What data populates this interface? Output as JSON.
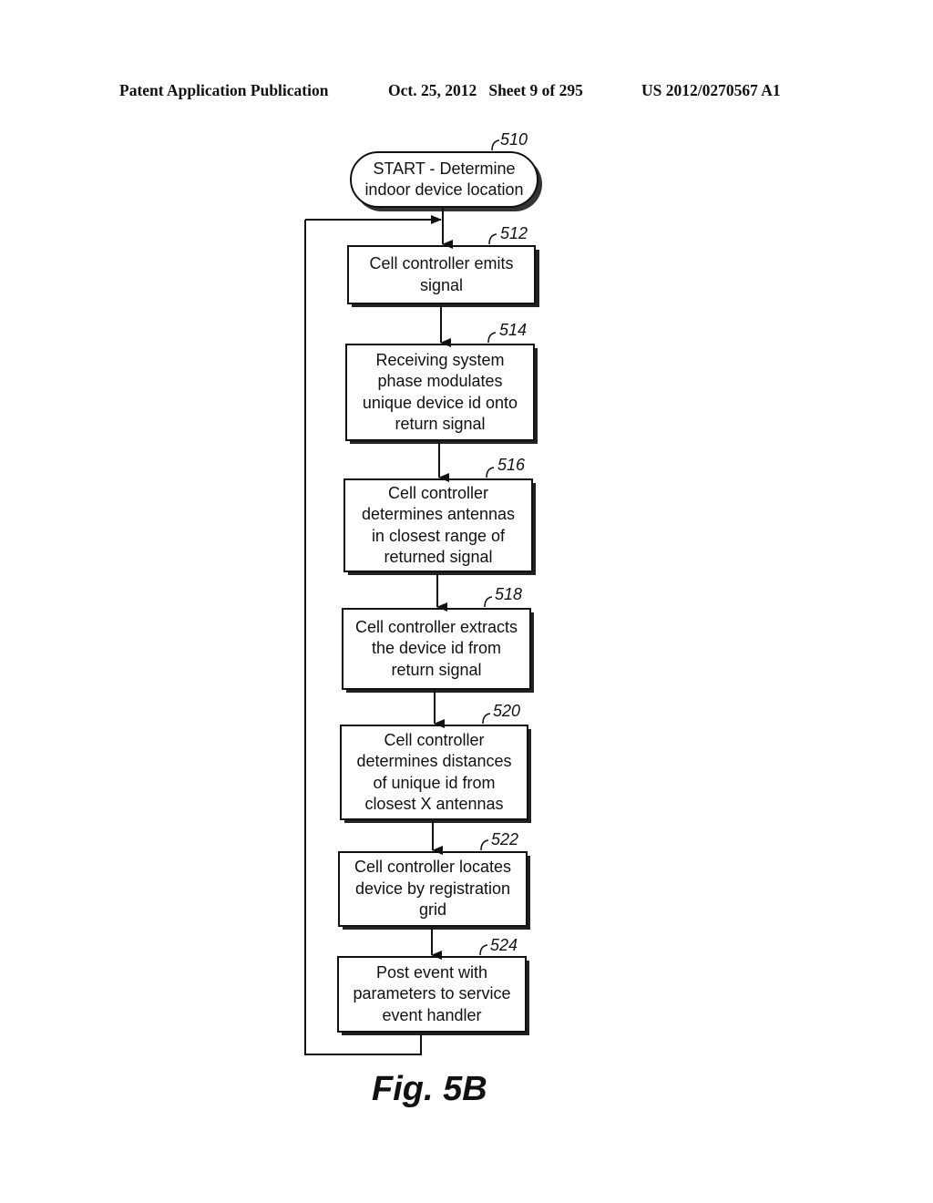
{
  "header": {
    "publication_type": "Patent Application Publication",
    "date_sheet": "Oct. 25, 2012   Sheet 9 of 295",
    "patent_number": "US 2012/0270567 A1"
  },
  "flowchart": {
    "start": {
      "ref": "510",
      "lines": [
        "START - Determine",
        "indoor device location"
      ]
    },
    "steps": [
      {
        "ref": "512",
        "lines": [
          "Cell controller emits",
          "signal"
        ]
      },
      {
        "ref": "514",
        "lines": [
          "Receiving system",
          "phase modulates",
          "unique device id onto",
          "return signal"
        ]
      },
      {
        "ref": "516",
        "lines": [
          "Cell controller",
          "determines antennas",
          "in closest range of",
          "returned signal"
        ]
      },
      {
        "ref": "518",
        "lines": [
          "Cell controller extracts",
          "the device id from",
          "return signal"
        ]
      },
      {
        "ref": "520",
        "lines": [
          "Cell controller",
          "determines distances",
          "of unique id from",
          "closest X antennas"
        ]
      },
      {
        "ref": "522",
        "lines": [
          "Cell controller locates",
          "device by registration",
          "grid"
        ]
      },
      {
        "ref": "524",
        "lines": [
          "Post event with",
          "parameters to service",
          "event handler"
        ]
      }
    ],
    "loop": "524 returns to 512"
  },
  "figure_label": "Fig. 5B"
}
